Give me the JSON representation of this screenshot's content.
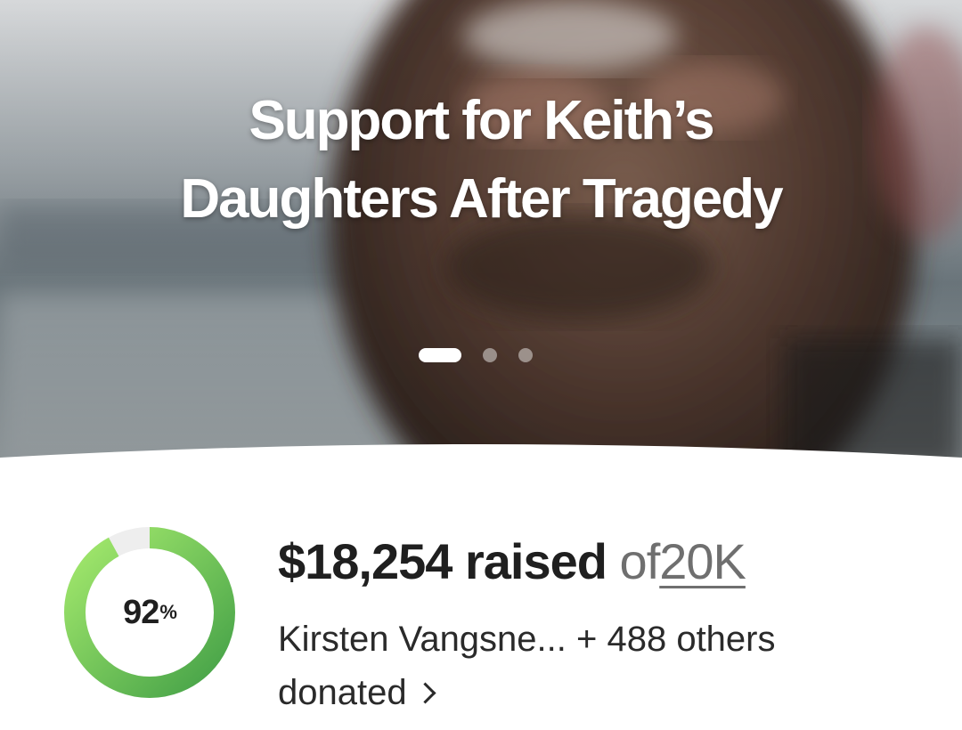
{
  "campaign": {
    "title": "Support for Keith’s Daughters After Tragedy",
    "carousel": {
      "total_slides": 3,
      "active_index": 0
    }
  },
  "fundraising": {
    "progress_percent_value": 92,
    "progress_percent": "92",
    "percent_sign": "%",
    "raised_amount": "$18,254 raised",
    "of_text": "of",
    "goal": "20K",
    "donors_text": "Kirsten Vangsne... + 488 others donated",
    "donors_icon": "chevron-right-icon"
  },
  "colors": {
    "progress_start": "#43a047",
    "progress_end": "#a5ea6d",
    "progress_track": "#eeeeee",
    "text_primary": "#1f1f1f",
    "text_muted": "#6f6f6f"
  }
}
